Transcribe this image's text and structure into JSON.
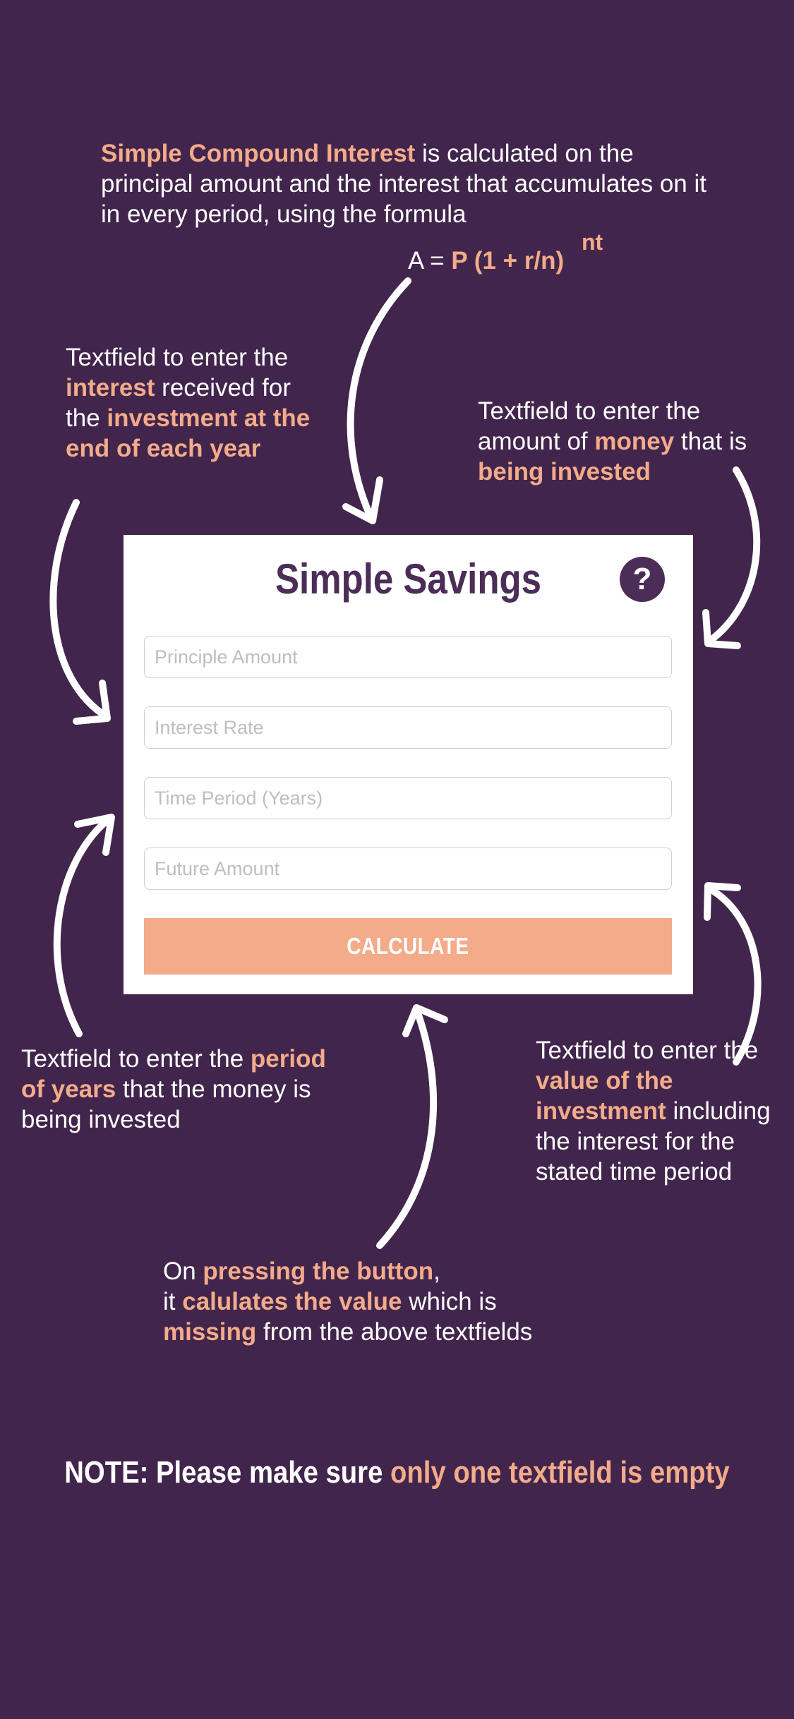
{
  "intro": {
    "highlight": "Simple Compound Interest",
    "text": " is calculated on the principal amount and the interest that accumulates on it in every period, using the formula"
  },
  "formula": {
    "prefix": "A = ",
    "expression": "P (1 + r/n)",
    "exponent": "nt"
  },
  "notes": {
    "interest": {
      "t1": "Textfield to enter the ",
      "h1": "interest",
      "t2": " received for the ",
      "h2": "investment at the end of each year"
    },
    "money": {
      "t1": "Textfield to enter the amount of ",
      "h1": "money",
      "t2": " that is ",
      "h2": "being invested"
    },
    "years": {
      "t1": "Textfield to enter the ",
      "h1": "period of years",
      "t2": " that the money is being invested"
    },
    "future": {
      "t1": "Textfield to enter the ",
      "h1": "value of the investment",
      "t2": " including the interest for the stated time period"
    },
    "button": {
      "t1": "On ",
      "h1": "pressing the button",
      "t2": ",",
      "t3": "it ",
      "h2": "calulates the value",
      "t4": " which is ",
      "h3": "missing",
      "t5": " from the above textfields"
    }
  },
  "card": {
    "title": "Simple Savings",
    "help_label": "?",
    "fields": {
      "principal": "Principle Amount",
      "rate": "Interest Rate",
      "time": "Time Period (Years)",
      "future": "Future Amount"
    },
    "button_label": "CALCULATE"
  },
  "footer": {
    "prefix": "NOTE: Please make sure ",
    "highlight": "only one textfield is empty"
  },
  "colors": {
    "background": "#41254c",
    "accent": "#f3ab8a",
    "title": "#4c2d58",
    "card": "#ffffff"
  }
}
